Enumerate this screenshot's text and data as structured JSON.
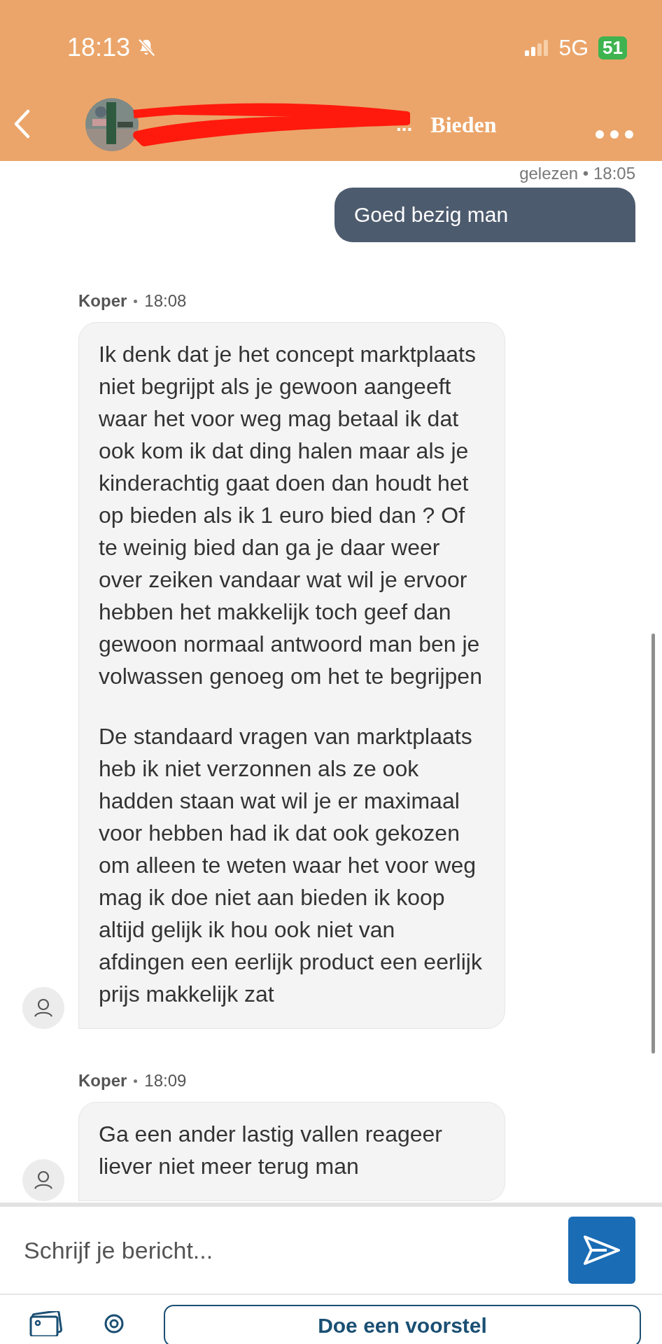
{
  "status_bar": {
    "time": "18:13",
    "network": "5G",
    "battery": "51"
  },
  "header": {
    "title": "...",
    "action": "Bieden"
  },
  "messages": [
    {
      "kind": "sent",
      "meta": "gelezen • 18:05",
      "paragraphs": [
        "Goed bezig man"
      ]
    },
    {
      "kind": "received",
      "sender": "Koper",
      "time": "18:08",
      "paragraphs": [
        "Ik denk dat je het concept marktplaats niet begrijpt als je gewoon aangeeft waar het voor weg mag betaal ik dat ook kom ik dat ding halen maar als je kinderachtig gaat doen dan houdt het op bieden als ik 1 euro bied dan ? Of te weinig bied dan ga je daar weer over zeiken vandaar wat wil je ervoor hebben het makkelijk toch geef dan gewoon normaal antwoord man ben je volwassen genoeg om het te begrijpen",
        "De standaard vragen van marktplaats heb ik niet verzonnen als ze ook hadden staan wat wil je er maximaal voor hebben had ik dat ook gekozen om alleen te weten waar het voor weg mag ik doe niet aan bieden ik koop altijd gelijk ik hou ook niet van afdingen een eerlijk product een eerlijk prijs makkelijk zat"
      ]
    },
    {
      "kind": "received",
      "sender": "Koper",
      "time": "18:09",
      "paragraphs": [
        "Ga een ander lastig vallen reageer liever niet meer terug man"
      ]
    }
  ],
  "composer": {
    "placeholder": "Schrijf je bericht..."
  },
  "proposal_button": "Doe een voorstel"
}
